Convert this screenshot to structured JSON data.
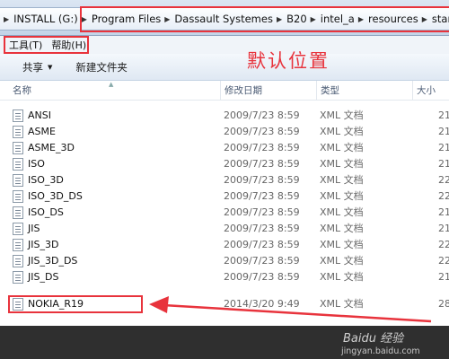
{
  "breadcrumb": {
    "items": [
      "INSTALL (G:)",
      "Program Files",
      "Dassault Systemes",
      "B20",
      "intel_a",
      "resources",
      "stan"
    ]
  },
  "menu": {
    "tools": "工具(T)",
    "help": "帮助(H)"
  },
  "toolbar": {
    "share": "共享",
    "new_folder": "新建文件夹"
  },
  "annotation": "默认位置",
  "columns": {
    "name": "名称",
    "modified": "修改日期",
    "type": "类型",
    "size": "大小"
  },
  "files": [
    {
      "name": "ANSI",
      "date": "2009/7/23 8:59",
      "type": "XML 文档",
      "size": "21"
    },
    {
      "name": "ASME",
      "date": "2009/7/23 8:59",
      "type": "XML 文档",
      "size": "21"
    },
    {
      "name": "ASME_3D",
      "date": "2009/7/23 8:59",
      "type": "XML 文档",
      "size": "21"
    },
    {
      "name": "ISO",
      "date": "2009/7/23 8:59",
      "type": "XML 文档",
      "size": "21"
    },
    {
      "name": "ISO_3D",
      "date": "2009/7/23 8:59",
      "type": "XML 文档",
      "size": "22"
    },
    {
      "name": "ISO_3D_DS",
      "date": "2009/7/23 8:59",
      "type": "XML 文档",
      "size": "22"
    },
    {
      "name": "ISO_DS",
      "date": "2009/7/23 8:59",
      "type": "XML 文档",
      "size": "21"
    },
    {
      "name": "JIS",
      "date": "2009/7/23 8:59",
      "type": "XML 文档",
      "size": "21"
    },
    {
      "name": "JIS_3D",
      "date": "2009/7/23 8:59",
      "type": "XML 文档",
      "size": "22"
    },
    {
      "name": "JIS_3D_DS",
      "date": "2009/7/23 8:59",
      "type": "XML 文档",
      "size": "22"
    },
    {
      "name": "JIS_DS",
      "date": "2009/7/23 8:59",
      "type": "XML 文档",
      "size": "21"
    },
    {
      "name": "NOKIA_R19",
      "date": "2014/3/20 9:49",
      "type": "XML 文档",
      "size": "28"
    }
  ],
  "watermark": {
    "logo": "Baidu 经验",
    "url": "jingyan.baidu.com"
  },
  "colors": {
    "highlight": "#e8333c",
    "background": "#ffffff"
  }
}
